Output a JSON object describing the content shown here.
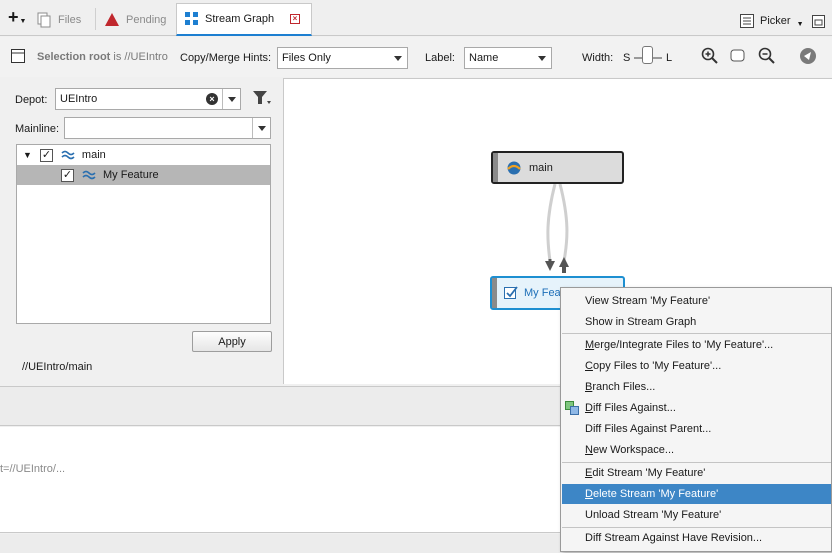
{
  "tabs": [
    {
      "label": "Files"
    },
    {
      "label": "Pending"
    },
    {
      "label": "Stream Graph"
    }
  ],
  "picker": {
    "label": "Picker"
  },
  "toolbar": {
    "selection_root_label": "Selection root",
    "selection_root_is": "is",
    "selection_root_value": "//UEIntro",
    "hints_label": "Copy/Merge Hints:",
    "hints_value": "Files Only",
    "label_label": "Label:",
    "label_value": "Name",
    "width_label": "Width:",
    "width_small": "S",
    "width_large": "L"
  },
  "left": {
    "depot_label": "Depot:",
    "depot_value": "UEIntro",
    "mainline_label": "Mainline:",
    "mainline_value": "",
    "tree": [
      {
        "label": "main",
        "checked": "✓"
      },
      {
        "label": "My Feature",
        "checked": "✓"
      }
    ],
    "apply_label": "Apply",
    "path": "//UEIntro/main"
  },
  "graph": {
    "node_main": "main",
    "node_feature": "My Feature"
  },
  "bottom": {
    "text": "t=//UEIntro/..."
  },
  "context_menu": {
    "items": [
      {
        "pre": "View Stream 'My Feature'",
        "u": "",
        "post": ""
      },
      {
        "pre": "Show in Stream Graph",
        "u": "",
        "post": ""
      },
      {
        "pre": "",
        "u": "M",
        "post": "erge/Integrate Files to 'My Feature'..."
      },
      {
        "pre": "",
        "u": "C",
        "post": "opy Files to 'My Feature'..."
      },
      {
        "pre": "",
        "u": "B",
        "post": "ranch Files..."
      },
      {
        "pre": "",
        "u": "D",
        "post": "iff Files Against..."
      },
      {
        "pre": "Diff Files Against Parent...",
        "u": "",
        "post": ""
      },
      {
        "pre": "",
        "u": "N",
        "post": "ew Workspace..."
      },
      {
        "pre": "",
        "u": "E",
        "post": "dit Stream 'My Feature'"
      },
      {
        "pre": "",
        "u": "D",
        "post": "elete Stream 'My Feature'"
      },
      {
        "pre": "Unload Stream 'My Feature'",
        "u": "",
        "post": ""
      },
      {
        "pre": "Diff Stream Against Have Revision...",
        "u": "",
        "post": ""
      }
    ]
  },
  "colors": {
    "accent": "#1d7fd1",
    "menu_highlight": "#3d86c6"
  }
}
